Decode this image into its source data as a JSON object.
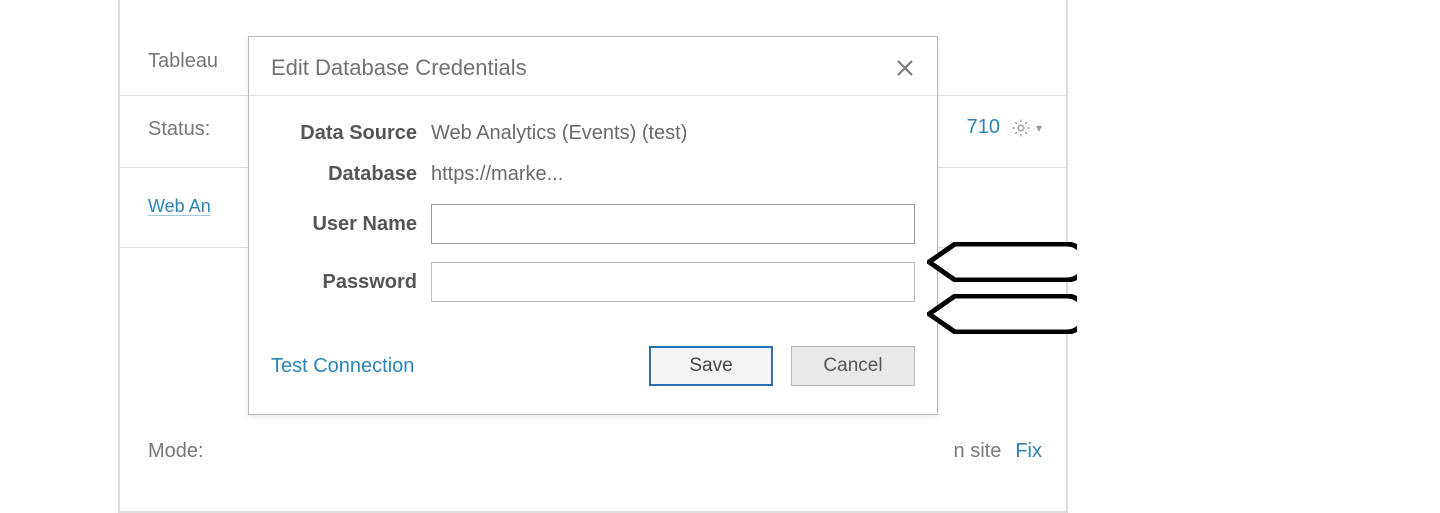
{
  "background": {
    "tab_label": "Tableau",
    "status_label": "Status:",
    "partial_link": "Web An",
    "header_right_fragment": "710",
    "mode_label": "Mode:",
    "footer_right_fragment": "n site",
    "fix_link": "Fix"
  },
  "dialog": {
    "title": "Edit Database Credentials",
    "data_source_label": "Data Source",
    "data_source_value": "Web Analytics (Events) (test)",
    "database_label": "Database",
    "database_value": "https://marke...",
    "username_label": "User Name",
    "username_value": "",
    "password_label": "Password",
    "password_value": "",
    "test_connection_label": "Test Connection",
    "save_label": "Save",
    "cancel_label": "Cancel"
  }
}
